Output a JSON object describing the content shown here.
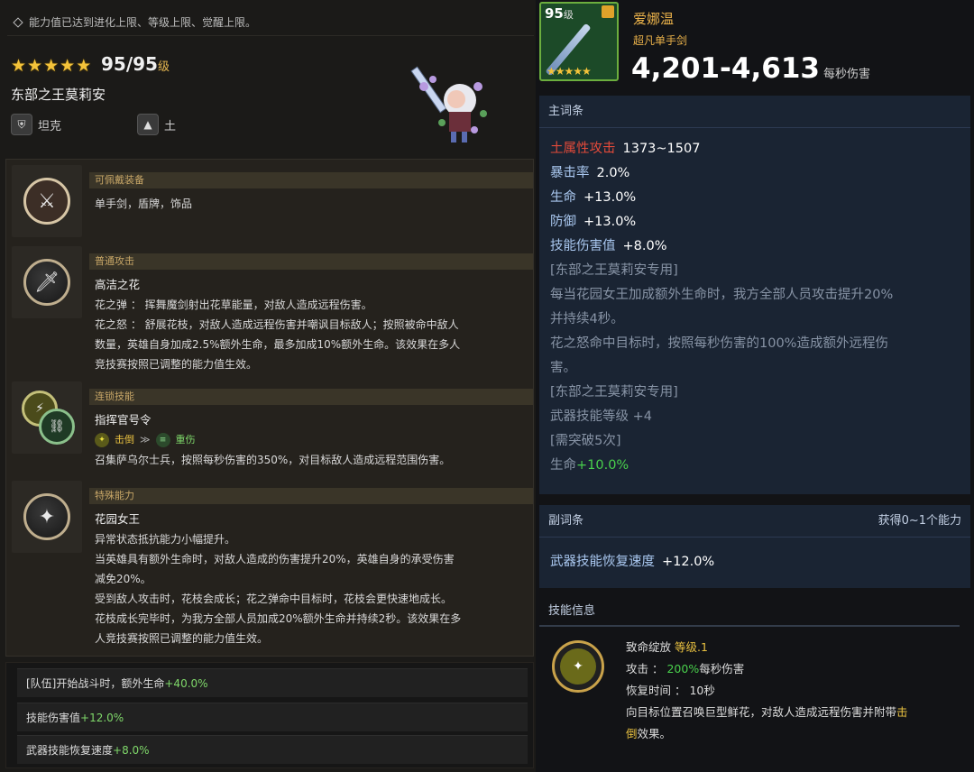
{
  "notice": "能力值已达到进化上限、等级上限、觉醒上限。",
  "hero": {
    "stars": 5,
    "level": "95/95",
    "level_unit": "级",
    "name": "东部之王莫莉安",
    "role": "坦克",
    "element": "土",
    "role_icon": "shield-icon",
    "element_icon": "mountain-icon"
  },
  "skills": {
    "equip": {
      "header": "可佩戴装备",
      "text": "单手剑，盾牌，饰品",
      "icon": "sword-shield-icon"
    },
    "normal": {
      "header": "普通攻击",
      "title": "高洁之花",
      "line1": "花之弹 ： 挥舞魔剑射出花草能量，对敌人造成远程伤害。",
      "line2": "花之怒 ： 舒展花枝，对敌人造成远程伤害并嘲讽目标敌人；按照被命中敌人",
      "line3": "数量，英雄自身加成2.5%额外生命，最多加成10%额外生命。该效果在多人",
      "line4": "竞技赛按照已调整的能力值生效。",
      "icon": "sword-icon"
    },
    "chain": {
      "header": "连锁技能",
      "title": "指挥官号令",
      "from": "击倒",
      "arrow": "≫",
      "to": "重伤",
      "desc": "召集萨乌尔士兵，按照每秒伤害的350%，对目标敌人造成远程范围伤害。",
      "icon": "chain-icon"
    },
    "special": {
      "header": "特殊能力",
      "title": "花园女王",
      "line1": "异常状态抵抗能力小幅提升。",
      "line2": "当英雄具有额外生命时，对敌人造成的伤害提升20%，英雄自身的承受伤害",
      "line3": "减免20%。",
      "line4": "受到敌人攻击时，花枝会成长；花之弹命中目标时，花枝会更快速地成长。",
      "line5": "花枝成长完毕时，为我方全部人员加成20%额外生命并持续2秒。该效果在多",
      "line6": "人竞技赛按照已调整的能力值生效。",
      "icon": "sparkle-icon"
    }
  },
  "buffs": [
    {
      "label": "[队伍]开始战斗时，额外生命",
      "value": "+40.0%"
    },
    {
      "label": "技能伤害值",
      "value": "+12.0%"
    },
    {
      "label": "武器技能恢复速度",
      "value": "+8.0%"
    }
  ],
  "weapon": {
    "level": "95",
    "level_unit": "级",
    "stars": 5,
    "name": "爱娜温",
    "type": "超凡单手剑",
    "dps": "4,201-4,613",
    "dps_unit": "每秒伤害"
  },
  "main_stats": {
    "header": "主词条",
    "rows": [
      {
        "label": "土属性攻击",
        "value": "1373~1507"
      },
      {
        "label": "暴击率",
        "value": "2.0%"
      },
      {
        "label": "生命",
        "value": "+13.0%"
      },
      {
        "label": "防御",
        "value": "+13.0%"
      },
      {
        "label": "技能伤害值",
        "value": "+8.0%"
      }
    ],
    "exclusive1": "[东部之王莫莉安专用]",
    "ex_line1": "每当花园女王加成额外生命时，我方全部人员攻击提升20%",
    "ex_line2": "并持续4秒。",
    "ex_line3": "花之怒命中目标时，按照每秒伤害的100%造成额外远程伤",
    "ex_line4": "害。",
    "exclusive2": "[东部之王莫莉安专用]",
    "wskill_label": "武器技能等级",
    "wskill_value": "+4",
    "limit": "[需突破5次]",
    "hp_label": "生命",
    "hp_value": "+10.0%"
  },
  "sub_stats": {
    "header": "副词条",
    "note": "获得0~1个能力",
    "label": "武器技能恢复速度",
    "value": "+12.0%"
  },
  "skill_info": {
    "header": "技能信息",
    "name": "致命绽放",
    "level": "等级.1",
    "atk_label": "攻击 ：",
    "atk_value": "200%",
    "atk_unit": "每秒伤害",
    "cd_label": "恢复时间 ：",
    "cd_value": "10秒",
    "desc1": "向目标位置召唤巨型鲜花，对敌人造成远程伤害并附带",
    "desc_hl": "击",
    "desc2a": "倒",
    "desc2b": "效果。"
  }
}
